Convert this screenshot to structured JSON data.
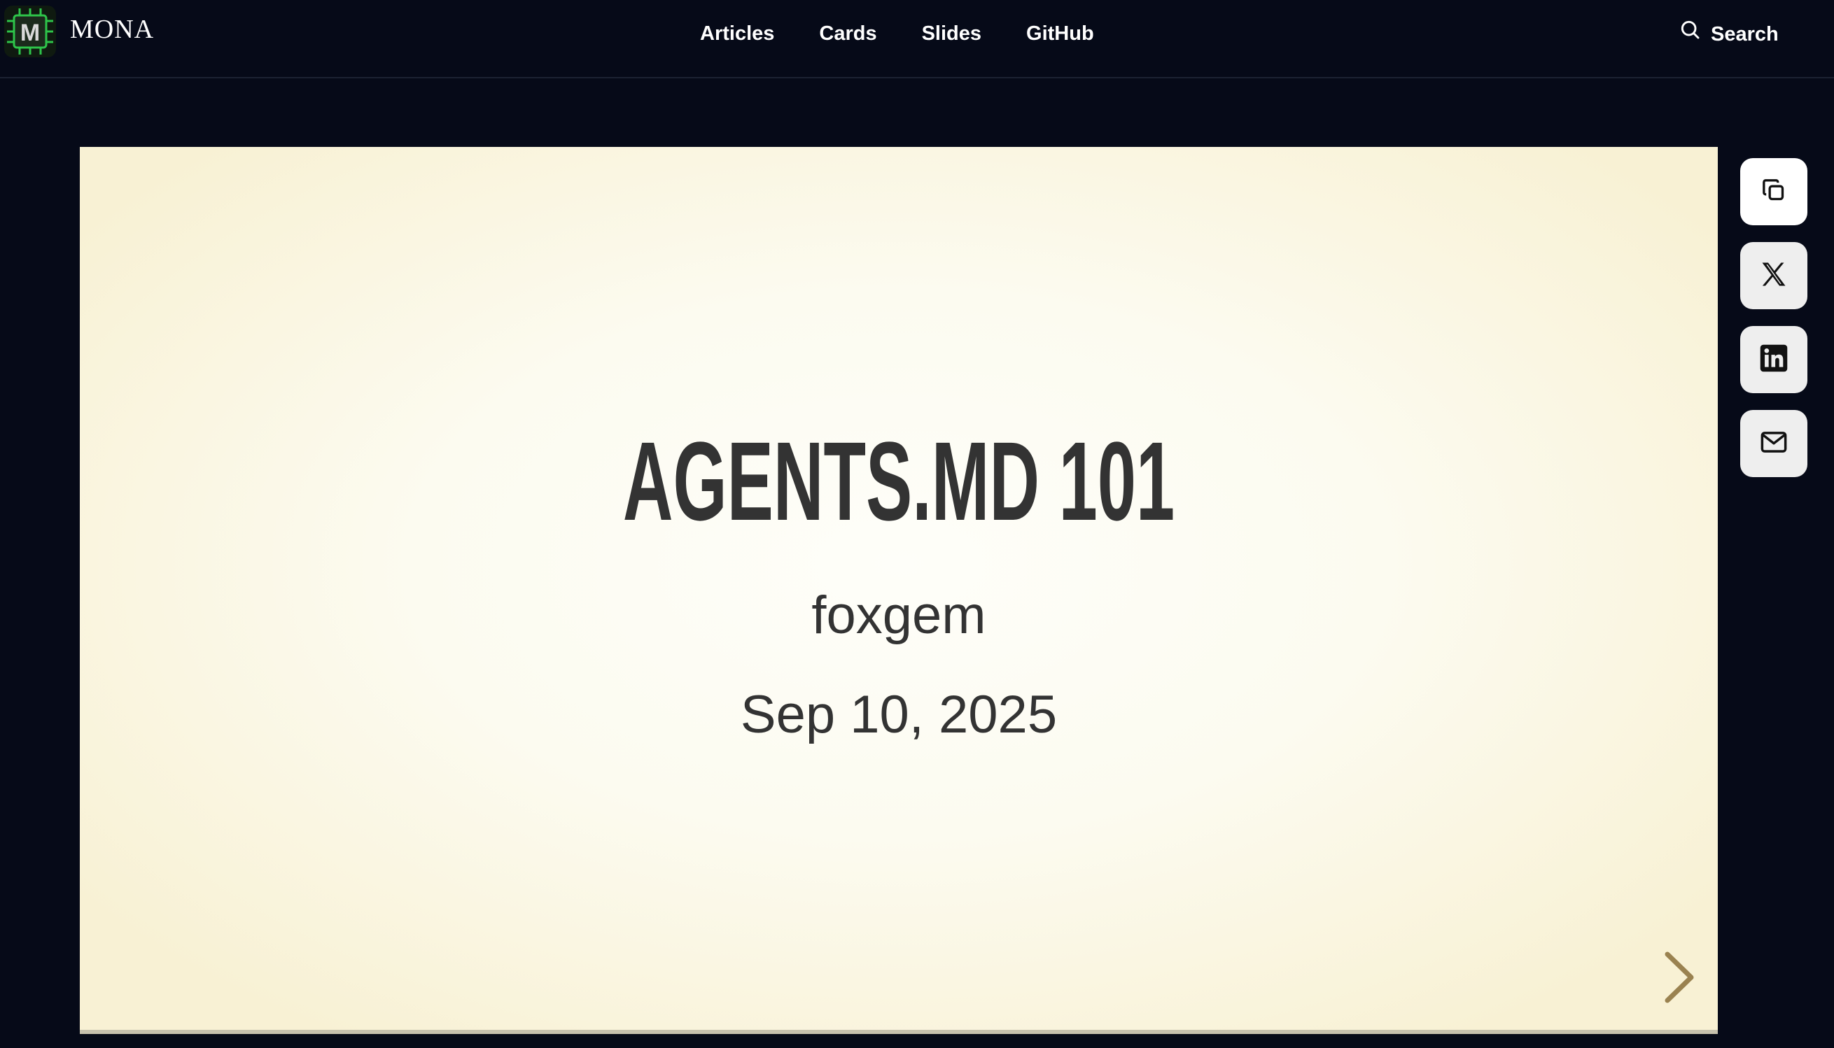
{
  "header": {
    "brand": "MONA",
    "logo_letter": "M",
    "logo_icon": "chip-logo-icon",
    "nav": [
      {
        "label": "Articles"
      },
      {
        "label": "Cards"
      },
      {
        "label": "Slides"
      },
      {
        "label": "GitHub"
      }
    ],
    "search_label": "Search",
    "search_icon": "search-icon"
  },
  "slide": {
    "title": "AGENTS.MD 101",
    "author": "foxgem",
    "date": "Sep 10, 2025",
    "next_icon": "chevron-right-icon"
  },
  "share": [
    {
      "icon": "copy-icon"
    },
    {
      "icon": "x-twitter-icon"
    },
    {
      "icon": "linkedin-icon"
    },
    {
      "icon": "mail-icon"
    }
  ],
  "colors": {
    "page_background": "#060a18",
    "slide_background": "#f8f1d4",
    "slide_text": "#333333",
    "accent_arrow": "#9a8250",
    "logo_green": "#22c55e"
  }
}
